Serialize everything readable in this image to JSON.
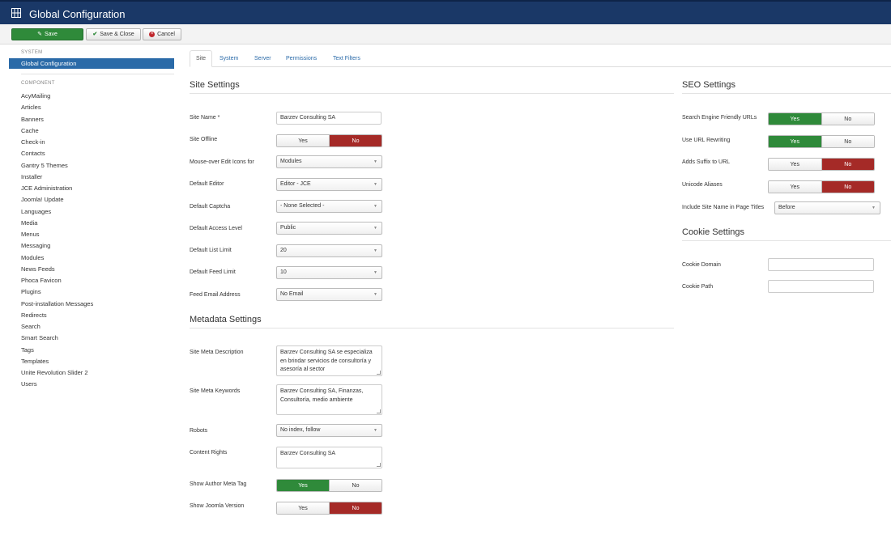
{
  "header": {
    "title": "Global Configuration",
    "icon": "grid-icon"
  },
  "toolbar": {
    "save": "Save",
    "save_close": "Save & Close",
    "cancel": "Cancel"
  },
  "sidebar": {
    "system_heading": "SYSTEM",
    "active_item": "Global Configuration",
    "component_heading": "COMPONENT",
    "items": [
      "AcyMailing",
      "Articles",
      "Banners",
      "Cache",
      "Check-in",
      "Contacts",
      "Gantry 5 Themes",
      "Installer",
      "JCE Administration",
      "Joomla! Update",
      "Languages",
      "Media",
      "Menus",
      "Messaging",
      "Modules",
      "News Feeds",
      "Phoca Favicon",
      "Plugins",
      "Post-installation Messages",
      "Redirects",
      "Search",
      "Smart Search",
      "Tags",
      "Templates",
      "Unite Revolution Slider 2",
      "Users"
    ]
  },
  "tabs": [
    "Site",
    "System",
    "Server",
    "Permissions",
    "Text Filters"
  ],
  "site_settings": {
    "heading": "Site Settings",
    "site_name": {
      "label": "Site Name *",
      "value": "Barzev Consulting SA"
    },
    "site_offline": {
      "label": "Site Offline",
      "yes": "Yes",
      "no": "No",
      "selected": "No"
    },
    "edit_icons": {
      "label": "Mouse-over Edit Icons for",
      "value": "Modules"
    },
    "default_editor": {
      "label": "Default Editor",
      "value": "Editor - JCE"
    },
    "default_captcha": {
      "label": "Default Captcha",
      "value": "- None Selected -"
    },
    "access_level": {
      "label": "Default Access Level",
      "value": "Public"
    },
    "list_limit": {
      "label": "Default List Limit",
      "value": "20"
    },
    "feed_limit": {
      "label": "Default Feed Limit",
      "value": "10"
    },
    "feed_email": {
      "label": "Feed Email Address",
      "value": "No Email"
    }
  },
  "metadata_settings": {
    "heading": "Metadata Settings",
    "meta_description": {
      "label": "Site Meta Description",
      "value": "Barzev Consulting SA se especializa en brindar servicios de consultoría y asesoría  al sector"
    },
    "meta_keywords": {
      "label": "Site Meta Keywords",
      "value": "Barzev Consulting SA, Finanzas, Consultoría, medio ambiente"
    },
    "robots": {
      "label": "Robots",
      "value": "No index, follow"
    },
    "content_rights": {
      "label": "Content Rights",
      "value": "Barzev Consulting SA"
    },
    "author_meta": {
      "label": "Show Author Meta Tag",
      "yes": "Yes",
      "no": "No",
      "selected": "Yes"
    },
    "joomla_version": {
      "label": "Show Joomla Version",
      "yes": "Yes",
      "no": "No",
      "selected": "No"
    }
  },
  "seo_settings": {
    "heading": "SEO Settings",
    "sef_urls": {
      "label": "Search Engine Friendly URLs",
      "yes": "Yes",
      "no": "No",
      "selected": "Yes"
    },
    "url_rewriting": {
      "label": "Use URL Rewriting",
      "yes": "Yes",
      "no": "No",
      "selected": "Yes"
    },
    "suffix": {
      "label": "Adds Suffix to URL",
      "yes": "Yes",
      "no": "No",
      "selected": "No"
    },
    "unicode": {
      "label": "Unicode Aliases",
      "yes": "Yes",
      "no": "No",
      "selected": "No"
    },
    "site_name_titles": {
      "label": "Include Site Name in Page Titles",
      "value": "Before"
    }
  },
  "cookie_settings": {
    "heading": "Cookie Settings",
    "domain": {
      "label": "Cookie Domain",
      "value": ""
    },
    "path": {
      "label": "Cookie Path",
      "value": ""
    }
  },
  "colors": {
    "header": "#1a3867",
    "accent": "#2a6aa8",
    "yes": "#2f8a3a",
    "no": "#a52a27"
  }
}
